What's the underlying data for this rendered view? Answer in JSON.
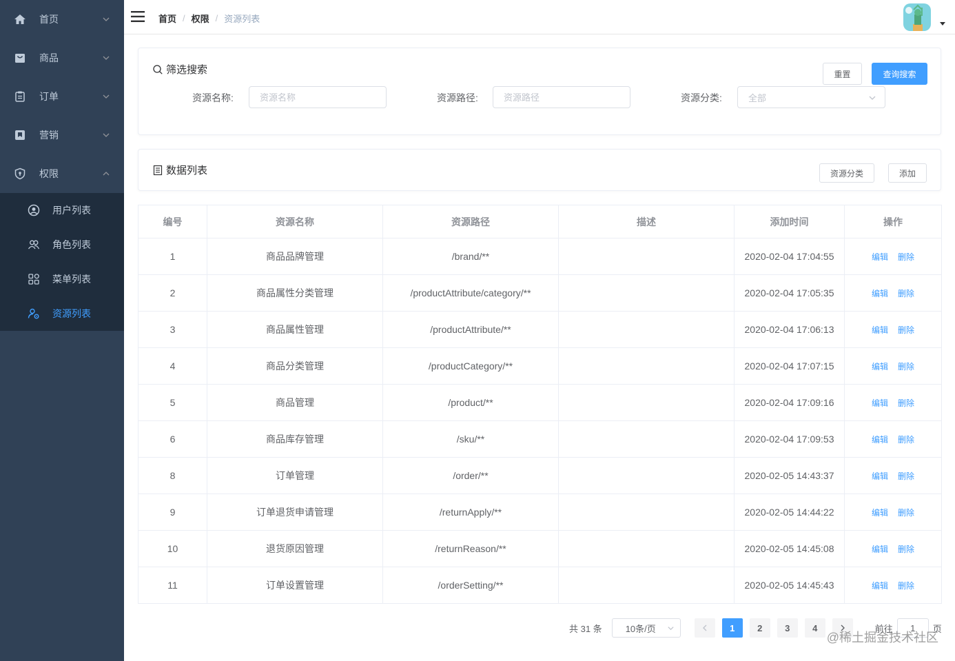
{
  "sidebar": {
    "items": [
      {
        "label": "首页",
        "icon": "home-icon"
      },
      {
        "label": "商品",
        "icon": "shopping-bag-icon"
      },
      {
        "label": "订单",
        "icon": "clipboard-icon"
      },
      {
        "label": "营销",
        "icon": "bookmark-icon"
      },
      {
        "label": "权限",
        "icon": "shield-icon",
        "expanded": true
      }
    ],
    "subitems": [
      {
        "label": "用户列表",
        "icon": "user-circle-icon"
      },
      {
        "label": "角色列表",
        "icon": "users-icon"
      },
      {
        "label": "菜单列表",
        "icon": "grid-icon"
      },
      {
        "label": "资源列表",
        "icon": "user-gear-icon",
        "active": true
      }
    ]
  },
  "navbar": {
    "breadcrumb": [
      "首页",
      "权限",
      "资源列表"
    ],
    "separator": "/"
  },
  "filter": {
    "title": "筛选搜索",
    "reset_label": "重置",
    "search_label": "查询搜索",
    "name_label": "资源名称:",
    "name_placeholder": "资源名称",
    "url_label": "资源路径:",
    "url_placeholder": "资源路径",
    "category_label": "资源分类:",
    "category_value": "全部"
  },
  "list": {
    "title": "数据列表",
    "category_button": "资源分类",
    "add_button": "添加"
  },
  "table": {
    "headers": [
      "编号",
      "资源名称",
      "资源路径",
      "描述",
      "添加时间",
      "操作"
    ],
    "edit_label": "编辑",
    "delete_label": "删除",
    "rows": [
      {
        "id": "1",
        "name": "商品品牌管理",
        "url": "/brand/**",
        "desc": "",
        "time": "2020-02-04 17:04:55"
      },
      {
        "id": "2",
        "name": "商品属性分类管理",
        "url": "/productAttribute/category/**",
        "desc": "",
        "time": "2020-02-04 17:05:35"
      },
      {
        "id": "3",
        "name": "商品属性管理",
        "url": "/productAttribute/**",
        "desc": "",
        "time": "2020-02-04 17:06:13"
      },
      {
        "id": "4",
        "name": "商品分类管理",
        "url": "/productCategory/**",
        "desc": "",
        "time": "2020-02-04 17:07:15"
      },
      {
        "id": "5",
        "name": "商品管理",
        "url": "/product/**",
        "desc": "",
        "time": "2020-02-04 17:09:16"
      },
      {
        "id": "6",
        "name": "商品库存管理",
        "url": "/sku/**",
        "desc": "",
        "time": "2020-02-04 17:09:53"
      },
      {
        "id": "8",
        "name": "订单管理",
        "url": "/order/**",
        "desc": "",
        "time": "2020-02-05 14:43:37"
      },
      {
        "id": "9",
        "name": "订单退货申请管理",
        "url": "/returnApply/**",
        "desc": "",
        "time": "2020-02-05 14:44:22"
      },
      {
        "id": "10",
        "name": "退货原因管理",
        "url": "/returnReason/**",
        "desc": "",
        "time": "2020-02-05 14:45:08"
      },
      {
        "id": "11",
        "name": "订单设置管理",
        "url": "/orderSetting/**",
        "desc": "",
        "time": "2020-02-05 14:45:43"
      }
    ]
  },
  "pagination": {
    "total_text": "共 31 条",
    "page_size": "10条/页",
    "pages": [
      "1",
      "2",
      "3",
      "4"
    ],
    "current": "1",
    "goto_label": "前往",
    "goto_value": "1",
    "page_suffix": "页"
  },
  "watermark": "@稀土掘金技术社区",
  "colors": {
    "sidebar_bg": "#304156",
    "submenu_bg": "#1f2d3d",
    "accent": "#409eff",
    "sidebar_text": "#bfcbd9"
  }
}
